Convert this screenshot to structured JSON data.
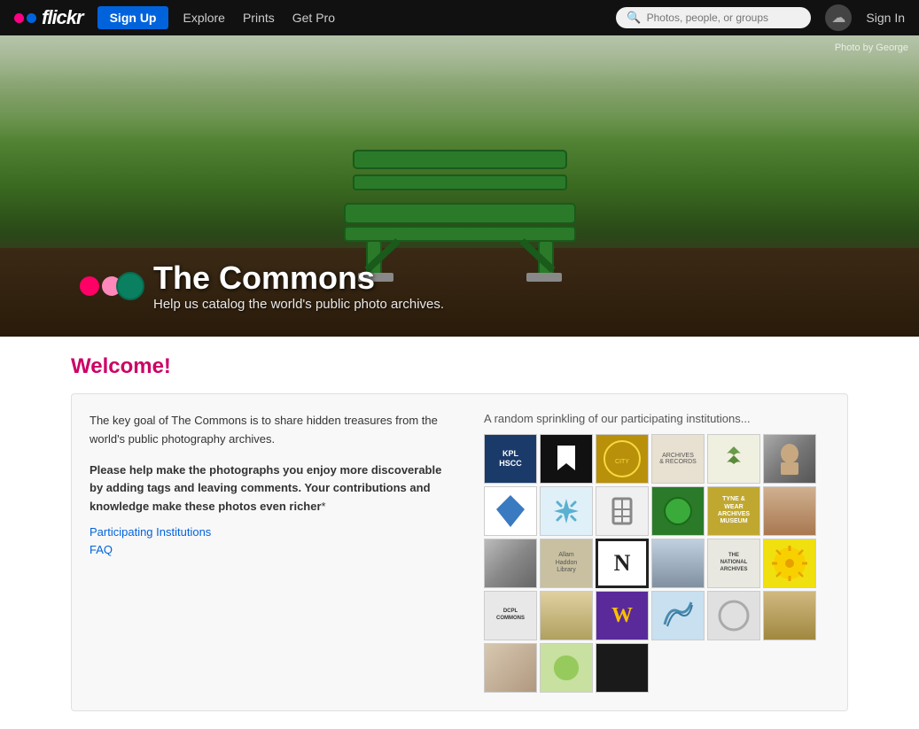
{
  "navbar": {
    "logo_text": "flickr",
    "signup_label": "Sign Up",
    "nav_items": [
      "Explore",
      "Prints",
      "Get Pro"
    ],
    "search_placeholder": "Photos, people, or groups",
    "signin_label": "Sign In"
  },
  "hero": {
    "photo_credit": "Photo by George",
    "title": "The Commons",
    "subtitle": "Help us catalog the world's public photo archives."
  },
  "content": {
    "welcome": "Welcome!",
    "intro_p1": "The key goal of The Commons is to share hidden treasures from the world's public photography archives.",
    "intro_p2_bold": "Please help make the photographs you enjoy more discoverable by adding tags and leaving comments. Your contributions and knowledge make these photos even richer",
    "intro_asterisk": "*",
    "institutions_title": "A random sprinkling of our participating institutions...",
    "participating_institutions_label": "Participating Institutions",
    "faq_label": "FAQ"
  }
}
